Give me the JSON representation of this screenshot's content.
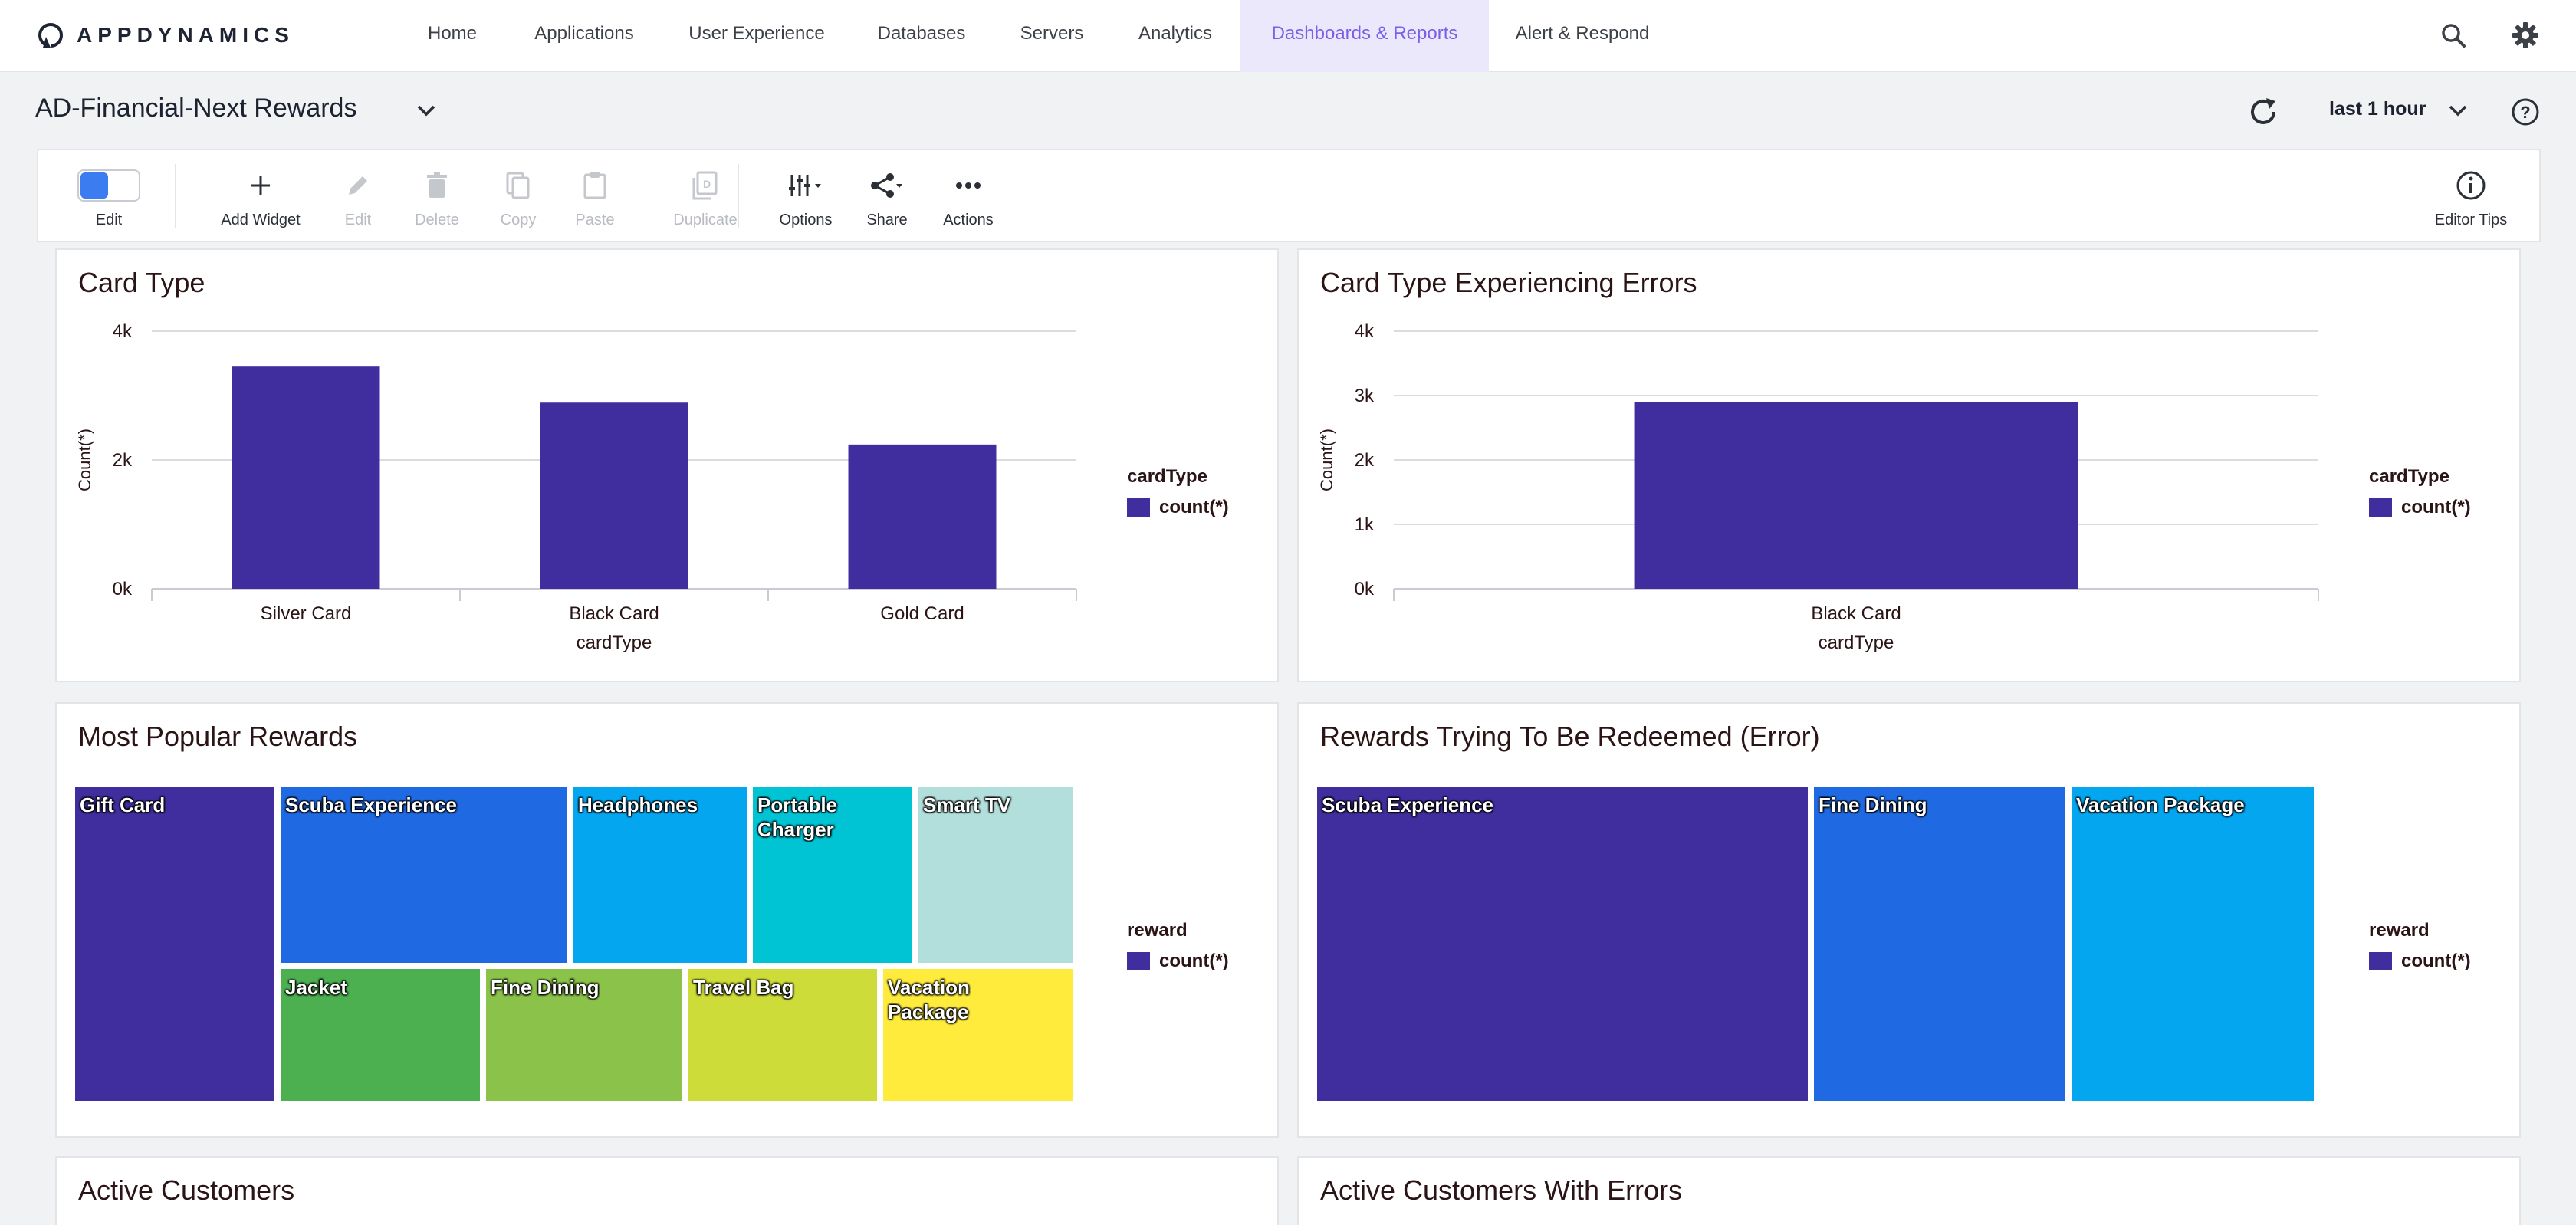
{
  "app": {
    "logo_text": "APPDYNAMICS"
  },
  "nav": {
    "items": [
      {
        "label": "Home"
      },
      {
        "label": "Applications"
      },
      {
        "label": "User Experience"
      },
      {
        "label": "Databases"
      },
      {
        "label": "Servers"
      },
      {
        "label": "Analytics"
      },
      {
        "label": "Dashboards & Reports",
        "active": true
      },
      {
        "label": "Alert & Respond"
      }
    ],
    "right_icons": [
      "search-icon",
      "gear-icon"
    ]
  },
  "dashboard": {
    "title": "AD-Financial-Next Rewards",
    "time_range": "last 1 hour"
  },
  "toolbar": {
    "edit": "Edit",
    "add_widget": "Add Widget",
    "edit_disabled": "Edit",
    "delete": "Delete",
    "copy": "Copy",
    "paste": "Paste",
    "duplicate": "Duplicate",
    "options": "Options",
    "share": "Share",
    "actions": "Actions",
    "editor_tips": "Editor Tips"
  },
  "widgets": {
    "card_type": {
      "title": "Card Type",
      "legend_title": "cardType",
      "legend_label": "count(*)"
    },
    "card_type_errors": {
      "title": "Card Type Experiencing Errors",
      "legend_title": "cardType",
      "legend_label": "count(*)"
    },
    "popular_rewards": {
      "title": "Most Popular Rewards",
      "legend_title": "reward",
      "legend_label": "count(*)",
      "tiles": [
        {
          "label": "Gift Card",
          "color": "#402d9e"
        },
        {
          "label": "Scuba Experience",
          "color": "#1f69e3"
        },
        {
          "label": "Headphones",
          "color": "#05a6f0"
        },
        {
          "label": "Portable Charger",
          "color": "#00c4d4"
        },
        {
          "label": "Smart TV",
          "color": "#b2dfdb"
        },
        {
          "label": "Jacket",
          "color": "#4caf50"
        },
        {
          "label": "Fine Dining",
          "color": "#8bc34a"
        },
        {
          "label": "Travel Bag",
          "color": "#cddc39"
        },
        {
          "label": "Vacation\nPackage",
          "color": "#ffeb3b"
        }
      ]
    },
    "rewards_errors": {
      "title": "Rewards Trying To Be Redeemed (Error)",
      "legend_title": "reward",
      "legend_label": "count(*)",
      "tiles": [
        {
          "label": "Scuba Experience",
          "color": "#402d9e"
        },
        {
          "label": "Fine Dining",
          "color": "#1f69e3"
        },
        {
          "label": "Vacation Package",
          "color": "#05a6f0"
        }
      ]
    },
    "active_customers": {
      "title": "Active Customers"
    },
    "active_customers_errors": {
      "title": "Active Customers With Errors"
    }
  },
  "chart_data": [
    {
      "type": "bar",
      "title": "Card Type",
      "categories": [
        "Silver Card",
        "Black Card",
        "Gold Card"
      ],
      "values": [
        3450,
        2890,
        2240
      ],
      "xlabel": "cardType",
      "ylabel": "Count(*)",
      "ylim": [
        0,
        4000
      ],
      "yticks": [
        "0k",
        "2k",
        "4k"
      ],
      "ytick_values": [
        0,
        2000,
        4000
      ],
      "series": [
        {
          "name": "count(*)",
          "values": [
            3450,
            2890,
            2240
          ]
        }
      ],
      "bar_color": "#402d9e",
      "grid": true,
      "legend_position": "right"
    },
    {
      "type": "bar",
      "title": "Card Type Experiencing Errors",
      "categories": [
        "Black Card"
      ],
      "values": [
        2900
      ],
      "xlabel": "cardType",
      "ylabel": "Count(*)",
      "ylim": [
        0,
        4000
      ],
      "yticks": [
        "0k",
        "1k",
        "2k",
        "3k",
        "4k"
      ],
      "ytick_values": [
        0,
        1000,
        2000,
        3000,
        4000
      ],
      "series": [
        {
          "name": "count(*)",
          "values": [
            2900
          ]
        }
      ],
      "bar_color": "#402d9e",
      "grid": true,
      "legend_position": "right"
    }
  ]
}
